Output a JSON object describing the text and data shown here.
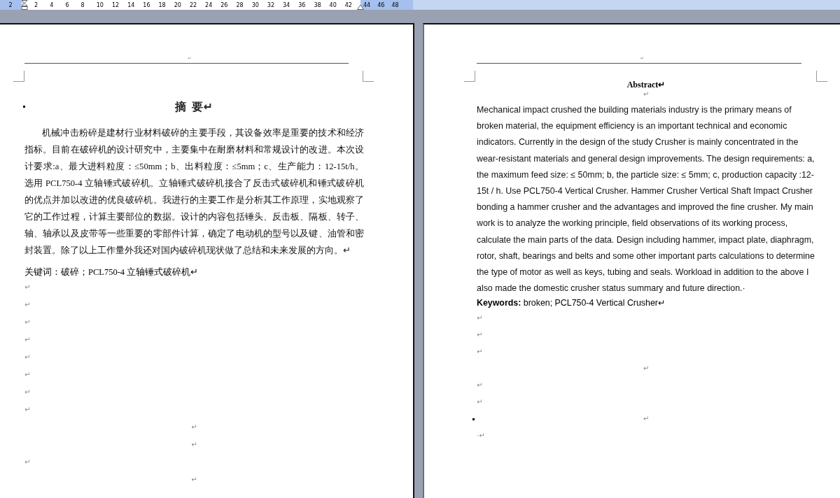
{
  "ruler": {
    "left_margin_labels": [
      "2"
    ],
    "labels": [
      "2",
      "4",
      "6",
      "8",
      "10",
      "12",
      "14",
      "16",
      "18",
      "20",
      "22",
      "24",
      "26",
      "28",
      "30",
      "32",
      "34",
      "36",
      "38",
      "40",
      "42"
    ],
    "right_margin_labels": [
      "44",
      "46",
      "48"
    ]
  },
  "pages": [
    {
      "kind": "chinese",
      "header_mark": "·↵",
      "title": "摘 要↵",
      "title_bullet": true,
      "body": "机械冲击粉碎是建材行业材料破碎的主要手段，其设备效率是重要的技术和经济指标。目前在破碎机的设计研究中，主要集中在耐磨材料和常规设计的改进。本次设计要求:a、最大进料粒度：≤50mm；b、出料粒度：≤5mm；c、生产能力：12-15t/h。选用 PCL750-4  立轴锤式破碎机。立轴锤式破碎机接合了反击式破碎机和锤式破碎机的优点并加以改进的优良破碎机。我进行的主要工作是分析其工作原理，实地观察了它的工作过程，计算主要部位的数据。设计的内容包括锤头、反击板、隔板、转子、轴、轴承以及皮带等一些重要的零部件计算，确定了电动机的型号以及键、油管和密封装置。除了以上工作量外我还对国内破碎机现状做了总结和未来发展的方向。↵",
      "keywords": "关键词：破碎；PCL750-4 立轴锤式破碎机↵",
      "marks": [
        {
          "kind": "indented",
          "text": "↵",
          "bullet": false
        },
        {
          "kind": "indented",
          "text": "↵",
          "bullet": false
        },
        {
          "kind": "indented",
          "text": "↵",
          "bullet": false
        },
        {
          "kind": "indented",
          "text": "↵",
          "bullet": false
        },
        {
          "kind": "indented",
          "text": "↵",
          "bullet": false
        },
        {
          "kind": "indented",
          "text": "↵",
          "bullet": false
        },
        {
          "kind": "indented",
          "text": "↵",
          "bullet": false
        },
        {
          "kind": "indented",
          "text": "↵",
          "bullet": false
        },
        {
          "kind": "centered",
          "text": "↵",
          "bullet": false
        },
        {
          "kind": "centered",
          "text": "↵",
          "bullet": false
        },
        {
          "kind": "indented",
          "text": "↵",
          "bullet": false
        },
        {
          "kind": "centered",
          "text": "↵",
          "bullet": false
        }
      ]
    },
    {
      "kind": "english",
      "header_mark": "·↵",
      "title": "Abstract↵",
      "title_bullet": false,
      "title_mark_after": "↵",
      "body": "Mechanical impact crushed the building materials industry is the primary means of broken material, the equipment efficiency is an important technical and economic indicators. Currently in the design of the study Crusher is mainly concentrated in the wear-resistant materials and general design improvements. The design requirements: a, the maximum feed size: ≤ 50mm; b, the particle size: ≤ 5mm; c, production capacity :12-15t / h. Use PCL750-4 Vertical Crusher. Hammer Crusher Vertical Shaft Impact Crusher bonding a hammer crusher and the advantages and improved the fine crusher. My main work is to analyze the working principle, field observations of its working process, calculate the main parts of the data. Design including hammer, impact plate, diaphragm, rotor, shaft, bearings and belts and some other important parts calculations to determine the type of motor as well as keys, tubing and seals. Workload in addition to the above I also made the domestic crusher status summary and future direction.·",
      "keywords": "**Keywords:** broken; PCL750-4 Vertical Crusher↵",
      "marks": [
        {
          "kind": "indented",
          "text": "↵",
          "bullet": false
        },
        {
          "kind": "indented",
          "text": "↵",
          "bullet": false
        },
        {
          "kind": "indented",
          "text": "↵",
          "bullet": false
        },
        {
          "kind": "centered",
          "text": "↵",
          "bullet": false
        },
        {
          "kind": "indented",
          "text": "↵",
          "bullet": false
        },
        {
          "kind": "indented",
          "text": "↵",
          "bullet": false
        },
        {
          "kind": "centered",
          "text": "↵",
          "bullet": true
        },
        {
          "kind": "indented",
          "text": "·↵",
          "bullet": false
        }
      ]
    }
  ]
}
